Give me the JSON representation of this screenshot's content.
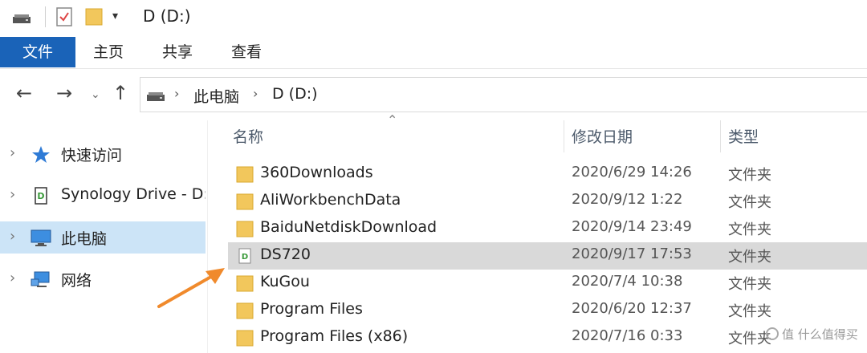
{
  "window": {
    "title": "D (D:)",
    "qa_dropdown": "▾"
  },
  "ribbon": {
    "tabs": [
      "文件",
      "主页",
      "共享",
      "查看"
    ]
  },
  "nav": {
    "back": "←",
    "forward": "→",
    "recent": "⌄",
    "up": "↑"
  },
  "address": {
    "chevron": "›",
    "crumbs": [
      "此电脑",
      "D (D:)"
    ]
  },
  "navpane": {
    "items": [
      {
        "label": "快速访问",
        "icon": "star-icon",
        "expander": "›"
      },
      {
        "label": "Synology Drive - D:",
        "icon": "synology-drive-icon",
        "expander": "›"
      },
      {
        "label": "此电脑",
        "icon": "computer-icon",
        "expander": "›",
        "selected": true
      },
      {
        "label": "网络",
        "icon": "network-icon",
        "expander": "›"
      }
    ]
  },
  "columns": {
    "sort_indicator": "⌃",
    "name": "名称",
    "date": "修改日期",
    "type": "类型"
  },
  "files": [
    {
      "name": "360Downloads",
      "date": "2020/6/29 14:26",
      "type": "文件夹",
      "icon": "folder-icon"
    },
    {
      "name": "AliWorkbenchData",
      "date": "2020/9/12 1:22",
      "type": "文件夹",
      "icon": "folder-icon"
    },
    {
      "name": "BaiduNetdiskDownload",
      "date": "2020/9/14 23:49",
      "type": "文件夹",
      "icon": "folder-icon"
    },
    {
      "name": "DS720",
      "date": "2020/9/17 17:53",
      "type": "文件夹",
      "icon": "synology-drive-icon",
      "selected": true
    },
    {
      "name": "KuGou",
      "date": "2020/7/4 10:38",
      "type": "文件夹",
      "icon": "folder-icon"
    },
    {
      "name": "Program Files",
      "date": "2020/6/20 12:37",
      "type": "文件夹",
      "icon": "folder-icon"
    },
    {
      "name": "Program Files (x86)",
      "date": "2020/7/16 0:33",
      "type": "文件夹",
      "icon": "folder-icon"
    }
  ],
  "watermark": "值 什么值得买",
  "colors": {
    "accent": "#1a63b8",
    "selection": "#cce4f7",
    "row_selected": "#d9d9d9",
    "folder": "#f2c75c",
    "arrow": "#f08a2c"
  }
}
